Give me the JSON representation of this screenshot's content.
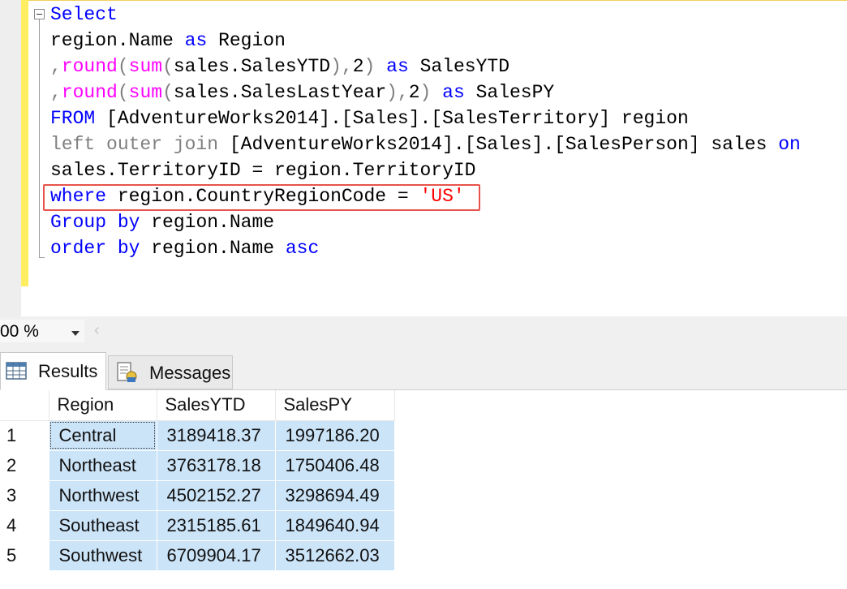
{
  "editor": {
    "keywords": {
      "select": "Select",
      "as": "as",
      "from": "FROM",
      "left_outer_join": "left outer join",
      "on": "on",
      "where": "where",
      "group_by": "Group by",
      "order_by": "order by",
      "asc": "asc",
      "round": "round",
      "sum": "sum"
    },
    "lines": {
      "l2": "region.Name",
      "l2b": "Region",
      "l3a": "sales.SalesYTD",
      "l3b": "2",
      "l3c": "SalesYTD",
      "l4a": "sales.SalesLastYear",
      "l4b": "2",
      "l4c": "SalesPY",
      "l5": "[AdventureWorks2014].[Sales].[SalesTerritory] region",
      "l6": "[AdventureWorks2014].[Sales].[SalesPerson] sales",
      "l7": "sales.TerritoryID = region.TerritoryID",
      "l8a": "region.CountryRegionCode = ",
      "l8b": "'US'",
      "l9": "region.Name",
      "l10": "region.Name"
    }
  },
  "zoom": {
    "value": "00 %"
  },
  "tabs": {
    "results": "Results",
    "messages": "Messages"
  },
  "grid": {
    "columns": [
      "Region",
      "SalesYTD",
      "SalesPY"
    ],
    "rows": [
      {
        "n": "1",
        "region": "Central",
        "ytd": "3189418.37",
        "py": "1997186.20"
      },
      {
        "n": "2",
        "region": "Northeast",
        "ytd": "3763178.18",
        "py": "1750406.48"
      },
      {
        "n": "3",
        "region": "Northwest",
        "ytd": "4502152.27",
        "py": "3298694.49"
      },
      {
        "n": "4",
        "region": "Southeast",
        "ytd": "2315185.61",
        "py": "1849640.94"
      },
      {
        "n": "5",
        "region": "Southwest",
        "ytd": "6709904.17",
        "py": "3512662.03"
      }
    ]
  },
  "colors": {
    "keyword": "#0000ff",
    "function": "#ff00ff",
    "operator": "#808080",
    "string": "#ff0000",
    "highlight_border": "#e8524a",
    "cell_selected": "#cce4f8",
    "margin_yellow": "#ffee62"
  },
  "icons": {
    "collapse": "collapse-minus-icon",
    "grid": "grid-icon",
    "messages": "messages-icon",
    "dropdown": "chevron-down-icon",
    "scroll": "chevron-left-icon"
  }
}
